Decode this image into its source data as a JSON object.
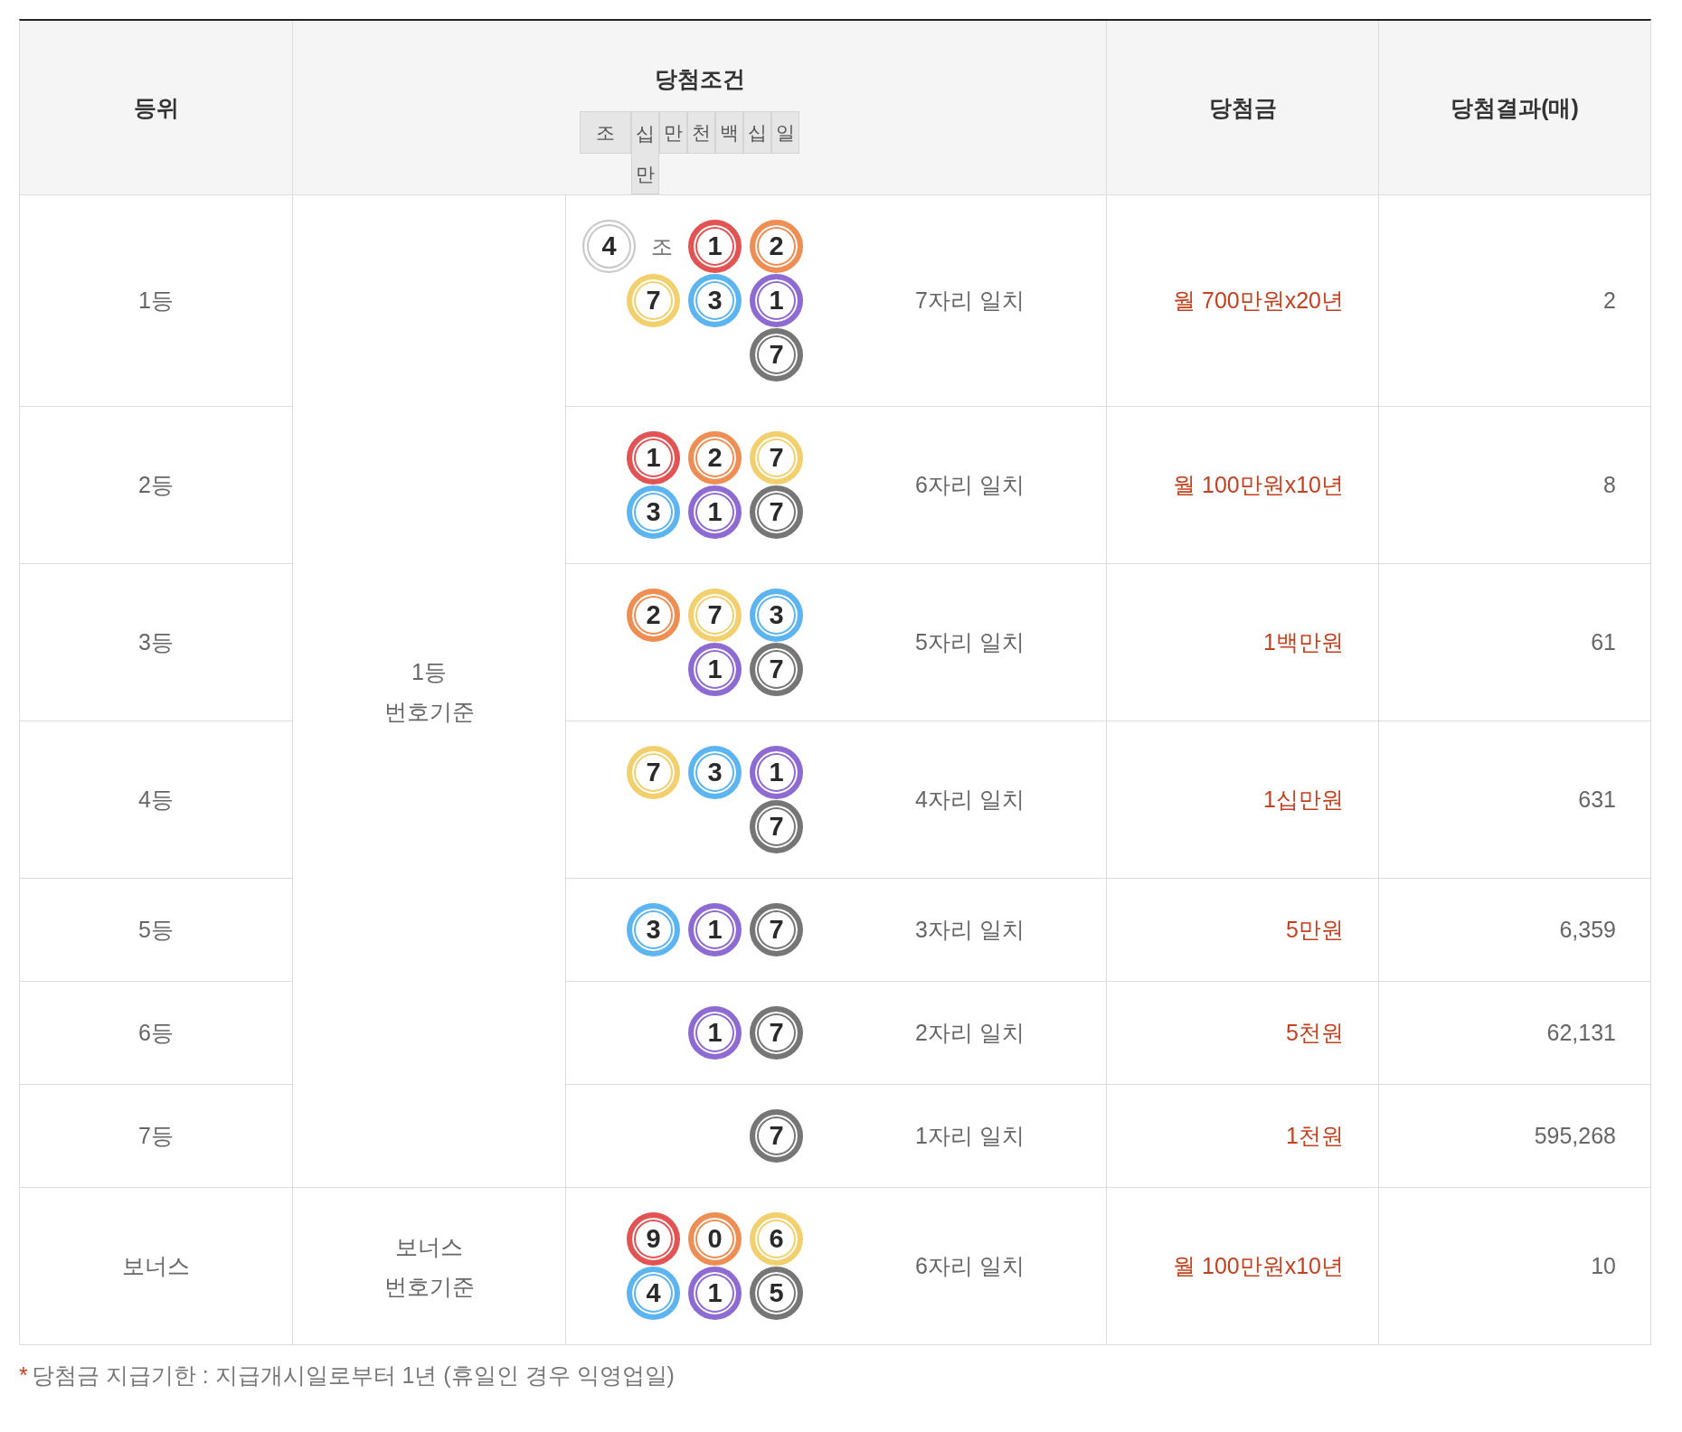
{
  "columns": [
    "등위",
    "당첨조건",
    "당첨금",
    "당첨결과(매)"
  ],
  "digit_places": [
    "조",
    "십만",
    "만",
    "천",
    "백",
    "십",
    "일"
  ],
  "groups": [
    {
      "basis": [
        "1등",
        "번호기준"
      ],
      "rows": [
        {
          "rank": "1등",
          "lines": [
            [
              {
                "kind": "group",
                "number": "4",
                "unit": "조"
              },
              {
                "kind": "ball",
                "number": "1",
                "color": "#e25353"
              },
              {
                "kind": "ball",
                "number": "2",
                "color": "#ee8e52"
              }
            ],
            [
              {
                "kind": "ball",
                "number": "7",
                "color": "#f2d06e"
              },
              {
                "kind": "ball",
                "number": "3",
                "color": "#5cb4f0"
              },
              {
                "kind": "ball",
                "number": "1",
                "color": "#8d6bd2"
              }
            ],
            [
              {
                "kind": "ball",
                "number": "7",
                "color": "#767676"
              }
            ]
          ],
          "match": "7자리 일치",
          "prize": "월 700만원x20년",
          "count": "2"
        },
        {
          "rank": "2등",
          "lines": [
            [
              {
                "kind": "ball",
                "number": "1",
                "color": "#e25353"
              },
              {
                "kind": "ball",
                "number": "2",
                "color": "#ee8e52"
              },
              {
                "kind": "ball",
                "number": "7",
                "color": "#f2d06e"
              }
            ],
            [
              {
                "kind": "ball",
                "number": "3",
                "color": "#5cb4f0"
              },
              {
                "kind": "ball",
                "number": "1",
                "color": "#8d6bd2"
              },
              {
                "kind": "ball",
                "number": "7",
                "color": "#767676"
              }
            ]
          ],
          "match": "6자리 일치",
          "prize": "월 100만원x10년",
          "count": "8"
        },
        {
          "rank": "3등",
          "lines": [
            [
              {
                "kind": "ball",
                "number": "2",
                "color": "#ee8e52"
              },
              {
                "kind": "ball",
                "number": "7",
                "color": "#f2d06e"
              },
              {
                "kind": "ball",
                "number": "3",
                "color": "#5cb4f0"
              }
            ],
            [
              {
                "kind": "ball",
                "number": "1",
                "color": "#8d6bd2"
              },
              {
                "kind": "ball",
                "number": "7",
                "color": "#767676"
              }
            ]
          ],
          "match": "5자리 일치",
          "prize": "1백만원",
          "count": "61"
        },
        {
          "rank": "4등",
          "lines": [
            [
              {
                "kind": "ball",
                "number": "7",
                "color": "#f2d06e"
              },
              {
                "kind": "ball",
                "number": "3",
                "color": "#5cb4f0"
              },
              {
                "kind": "ball",
                "number": "1",
                "color": "#8d6bd2"
              }
            ],
            [
              {
                "kind": "ball",
                "number": "7",
                "color": "#767676"
              }
            ]
          ],
          "match": "4자리 일치",
          "prize": "1십만원",
          "count": "631"
        },
        {
          "rank": "5등",
          "lines": [
            [
              {
                "kind": "ball",
                "number": "3",
                "color": "#5cb4f0"
              },
              {
                "kind": "ball",
                "number": "1",
                "color": "#8d6bd2"
              },
              {
                "kind": "ball",
                "number": "7",
                "color": "#767676"
              }
            ]
          ],
          "match": "3자리 일치",
          "prize": "5만원",
          "count": "6,359"
        },
        {
          "rank": "6등",
          "lines": [
            [
              {
                "kind": "ball",
                "number": "1",
                "color": "#8d6bd2"
              },
              {
                "kind": "ball",
                "number": "7",
                "color": "#767676"
              }
            ]
          ],
          "match": "2자리 일치",
          "prize": "5천원",
          "count": "62,131"
        },
        {
          "rank": "7등",
          "lines": [
            [
              {
                "kind": "ball",
                "number": "7",
                "color": "#767676"
              }
            ]
          ],
          "match": "1자리 일치",
          "prize": "1천원",
          "count": "595,268"
        }
      ]
    },
    {
      "basis": [
        "보너스",
        "번호기준"
      ],
      "rows": [
        {
          "rank": "보너스",
          "lines": [
            [
              {
                "kind": "ball",
                "number": "9",
                "color": "#e25353"
              },
              {
                "kind": "ball",
                "number": "0",
                "color": "#ee8e52"
              },
              {
                "kind": "ball",
                "number": "6",
                "color": "#f2d06e"
              }
            ],
            [
              {
                "kind": "ball",
                "number": "4",
                "color": "#5cb4f0"
              },
              {
                "kind": "ball",
                "number": "1",
                "color": "#8d6bd2"
              },
              {
                "kind": "ball",
                "number": "5",
                "color": "#767676"
              }
            ]
          ],
          "match": "6자리 일치",
          "prize": "월 100만원x10년",
          "count": "10"
        }
      ]
    }
  ],
  "footnote": {
    "mark": "*",
    "text": "당첨금 지급기한 : 지급개시일로부터 1년 (휴일인 경우 익영업일)"
  }
}
